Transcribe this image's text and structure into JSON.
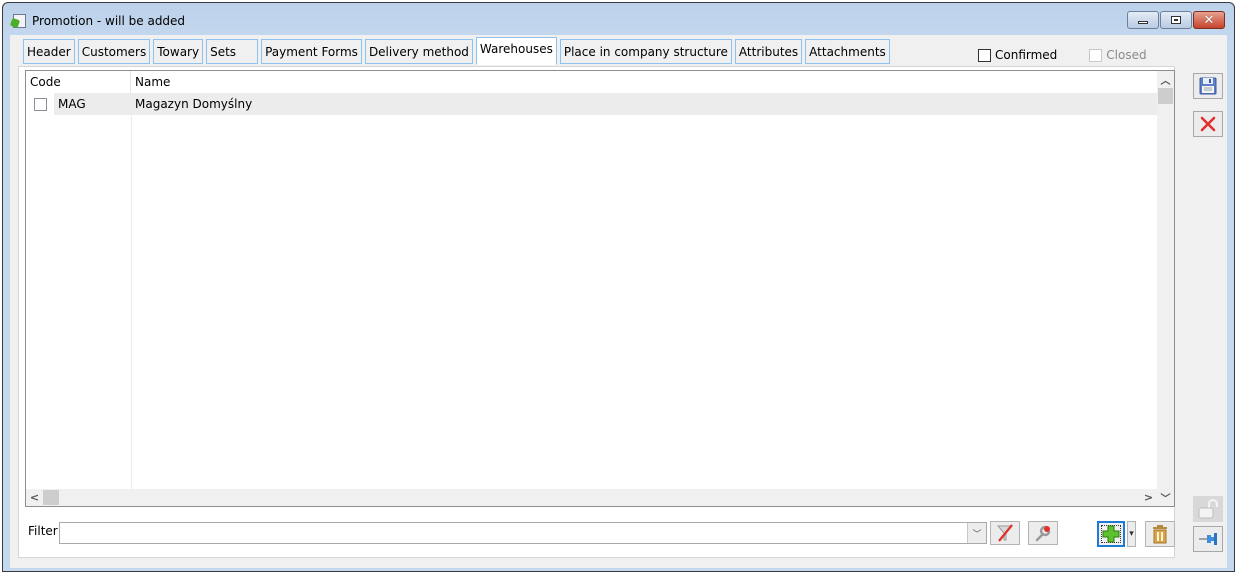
{
  "window": {
    "title": "Promotion - will be added",
    "controls": {
      "minimize": "minimize-icon",
      "maximize": "maximize-icon",
      "close": "close-icon"
    }
  },
  "tabs": [
    {
      "label": "Header",
      "active": false
    },
    {
      "label": "Customers",
      "active": false
    },
    {
      "label": "Towary",
      "active": false
    },
    {
      "label": "Sets",
      "active": false
    },
    {
      "label": "Payment Forms",
      "active": false
    },
    {
      "label": "Delivery method",
      "active": false
    },
    {
      "label": "Warehouses",
      "active": true
    },
    {
      "label": "Place in company structure",
      "active": false
    },
    {
      "label": "Attributes",
      "active": false
    },
    {
      "label": "Attachments",
      "active": false
    }
  ],
  "status_checks": {
    "confirmed": {
      "label": "Confirmed",
      "checked": false,
      "enabled": true
    },
    "closed": {
      "label": "Closed",
      "checked": false,
      "enabled": false
    }
  },
  "grid": {
    "columns": [
      "Code",
      "Name"
    ],
    "rows": [
      {
        "checked": false,
        "code": "MAG",
        "name": "Magazyn Domyślny"
      }
    ]
  },
  "filter": {
    "label": "Filter",
    "value": "",
    "placeholder": ""
  },
  "icons": {
    "save": "floppy-disk-icon",
    "cancel": "red-x-icon",
    "clear_filter": "funnel-clear-icon",
    "configure_filter": "wrench-icon",
    "add": "green-plus-icon",
    "delete": "trash-icon",
    "unlock": "padlock-open-icon",
    "pin": "pushpin-icon"
  },
  "colors": {
    "tab_border": "#8cc2ef",
    "focus_border": "#1e7ad8",
    "close_button": "#c6432c",
    "add_green": "#4caf2a"
  }
}
